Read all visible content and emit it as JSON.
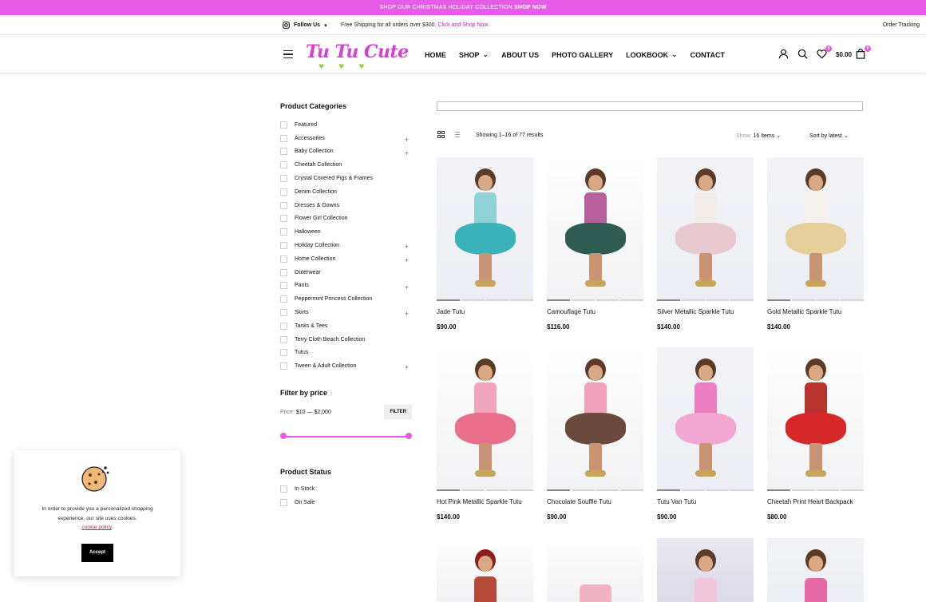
{
  "promo": {
    "text": "SHOP OUR CHRISTMAS HOLIDAY COLLECTION",
    "cta": "SHOP NOW"
  },
  "topbar": {
    "follow": "Follow Us",
    "shipping": "Free Shipping for all orders over $300.",
    "shipping_link": "Click and Shop Now.",
    "tracking": "Order Tracking"
  },
  "logo": {
    "text": "Tu Tu Cute"
  },
  "nav": [
    "HOME",
    "SHOP",
    "ABOUT US",
    "PHOTO GALLERY",
    "LOOKBOOK",
    "CONTACT"
  ],
  "cart": {
    "total": "$0.00",
    "wishlist_count": "0",
    "cart_count": "0"
  },
  "sidebar": {
    "categories_title": "Product Categories",
    "categories": [
      {
        "label": "Featured",
        "expand": false
      },
      {
        "label": "Accessories",
        "expand": true
      },
      {
        "label": "Baby Collection",
        "expand": true
      },
      {
        "label": "Cheetah Collection",
        "expand": false
      },
      {
        "label": "Crystal Covered Pigs & Frames",
        "expand": false
      },
      {
        "label": "Denim Collection",
        "expand": false
      },
      {
        "label": "Dresses & Gowns",
        "expand": false
      },
      {
        "label": "Flower Girl Collection",
        "expand": false
      },
      {
        "label": "Halloween",
        "expand": false
      },
      {
        "label": "Holiday Collection",
        "expand": true
      },
      {
        "label": "Home Collection",
        "expand": true
      },
      {
        "label": "Outerwear",
        "expand": false
      },
      {
        "label": "Pants",
        "expand": true
      },
      {
        "label": "Peppermint Princess Collection",
        "expand": false
      },
      {
        "label": "Skirts",
        "expand": true
      },
      {
        "label": "Tanks & Tees",
        "expand": false
      },
      {
        "label": "Terry Cloth Beach Collection",
        "expand": false
      },
      {
        "label": "Tutus",
        "expand": false
      },
      {
        "label": "Tween & Adult Collection",
        "expand": true
      }
    ],
    "price_title": "Filter by price",
    "price_label": "Price:",
    "price_range": "$10 — $2,000",
    "filter_button": "FILTER",
    "status_title": "Product Status",
    "status": [
      "In Stock",
      "On Sale"
    ]
  },
  "toolbar": {
    "count": "Showing 1–16 of 77 results",
    "show_label": "Show:",
    "show_value": "16 Items",
    "sort": "Sort by latest"
  },
  "products": [
    {
      "name": "Jade Tutu",
      "price": "$90.00",
      "top": "#8fd3d8",
      "skirt": "#3bb2b8"
    },
    {
      "name": "Camouflage Tutu",
      "price": "$116.00",
      "top": "#b85f9d",
      "skirt": "#2f5b52"
    },
    {
      "name": "Silver Metallic Sparkle Tutu",
      "price": "$140.00",
      "top": "#f4eeea",
      "skirt": "#e7c9cf"
    },
    {
      "name": "Gold Metallic Sparkle Tutu",
      "price": "$140.00",
      "top": "#f6f1ec",
      "skirt": "#e6cf9a"
    },
    {
      "name": "Hot Pink Metallic Sparkle Tutu",
      "price": "$140.00",
      "top": "#f2a3bd",
      "skirt": "#ea6f8d"
    },
    {
      "name": "Chocolate Souffle Tutu",
      "price": "$90.00",
      "top": "#f1a1bb",
      "skirt": "#6b4a3e"
    },
    {
      "name": "Tutu Van Tutu",
      "price": "$90.00",
      "top": "#ec7fc1",
      "skirt": "#f1a7cf"
    },
    {
      "name": "Cheetah Print Heart Backpack",
      "price": "$80.00",
      "top": "#b9332f",
      "skirt": "#d62828"
    }
  ],
  "cookie": {
    "message": "In order to provide you a personalized shopping experience, our site uses cookies.",
    "policy": "cookie policy",
    "accept": "Accept"
  }
}
